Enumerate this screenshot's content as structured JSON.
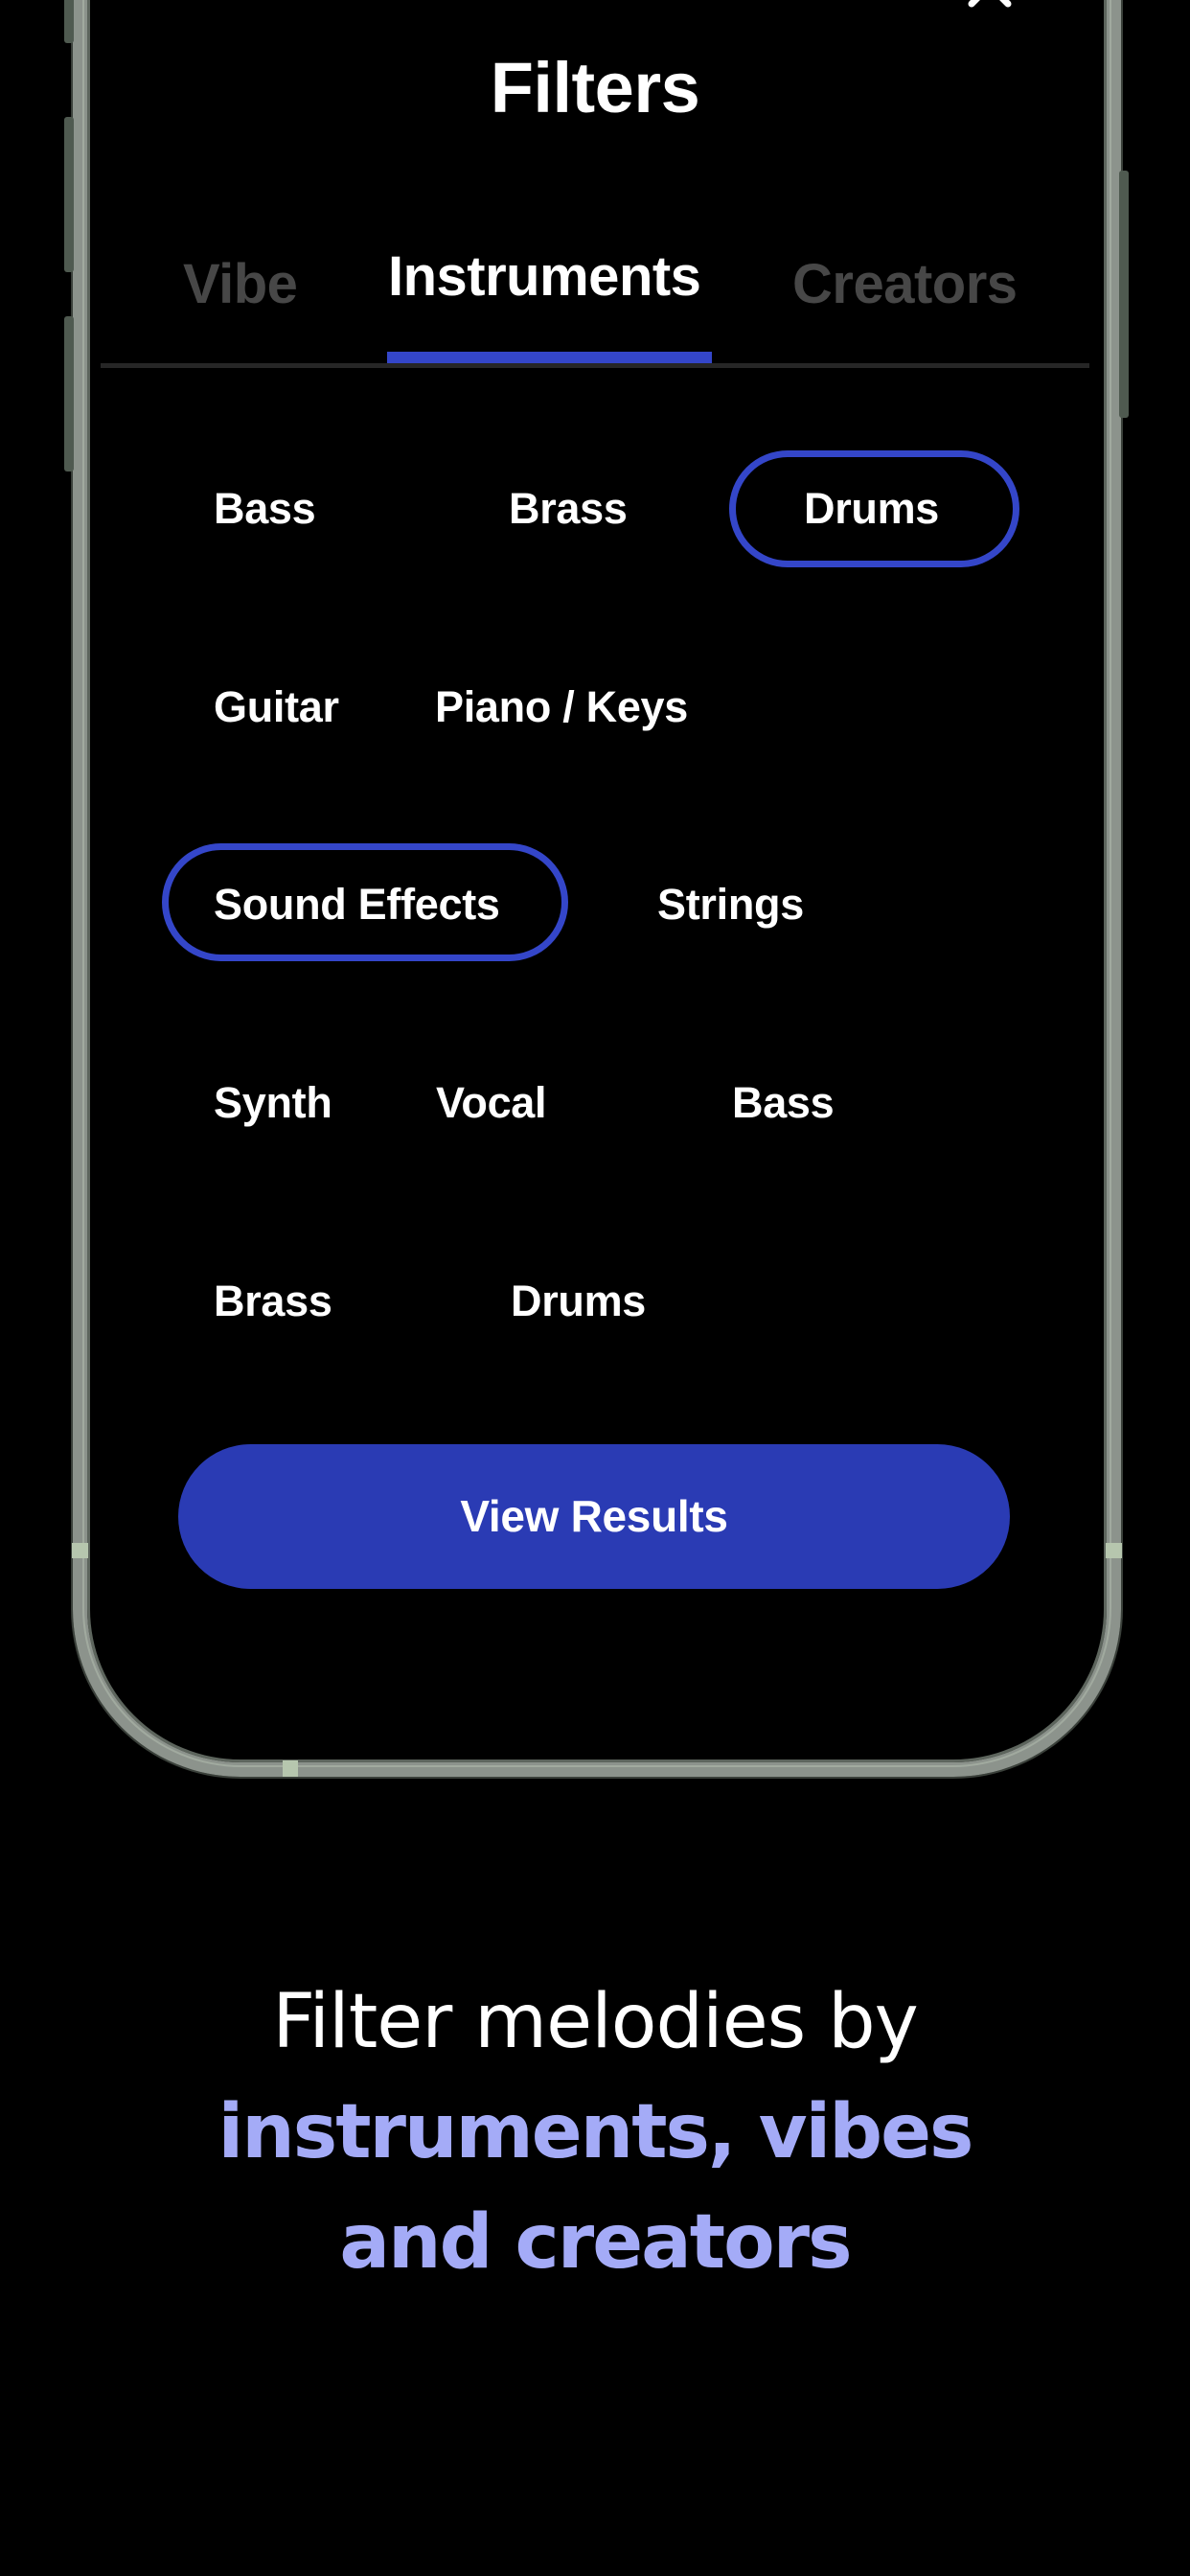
{
  "header": {
    "title": "Filters",
    "close_icon": "close-icon"
  },
  "tabs": [
    {
      "label": "Vibe",
      "active": false
    },
    {
      "label": "Instruments",
      "active": true
    },
    {
      "label": "Creators",
      "active": false
    }
  ],
  "chips": [
    {
      "label": "Bass",
      "selected": false
    },
    {
      "label": "Brass",
      "selected": false
    },
    {
      "label": "Drums",
      "selected": true
    },
    {
      "label": "Guitar",
      "selected": false
    },
    {
      "label": "Piano / Keys",
      "selected": false
    },
    {
      "label": "Sound Effects",
      "selected": true
    },
    {
      "label": "Strings",
      "selected": false
    },
    {
      "label": "Synth",
      "selected": false
    },
    {
      "label": "Vocal",
      "selected": false
    },
    {
      "label": "Bass",
      "selected": false
    },
    {
      "label": "Brass",
      "selected": false
    },
    {
      "label": "Drums",
      "selected": false
    }
  ],
  "actions": {
    "view_results": "View Results"
  },
  "caption": {
    "line1": "Filter melodies by",
    "line2": "instruments, vibes",
    "line3": "and creators"
  },
  "colors": {
    "accent": "#3446c9",
    "button": "#2a3bb4",
    "highlight_text": "#a4abf7",
    "inactive_tab": "#474747",
    "background": "#000000"
  }
}
